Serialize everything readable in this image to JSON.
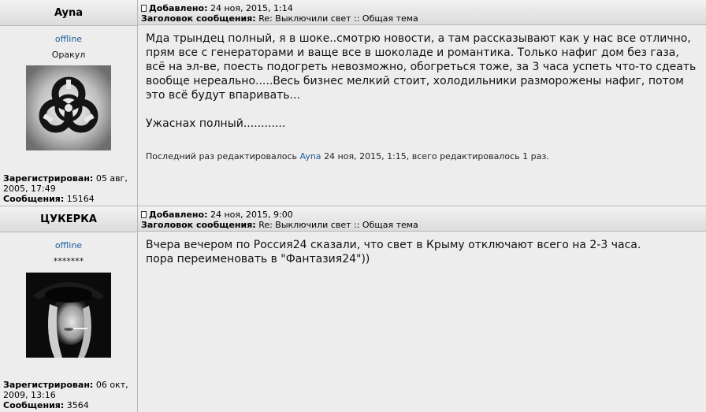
{
  "posts": [
    {
      "author": "Ayna",
      "status": "offline",
      "rank": "Оракул",
      "avatar_icon": "biohazard-icon",
      "registered_label": "Зарегистрирован:",
      "registered": "05 авг, 2005, 17:49",
      "messages_label": "Сообщения:",
      "messages": "15164",
      "added_label": "Добавлено:",
      "added": "24 ноя, 2015, 1:14",
      "subject_label": "Заголовок сообщения:",
      "subject": "Re: Выключили свет :: Общая тема",
      "body_lines": [
        "Мда трындец полный, я в шоке..смотрю новости, а там рассказывают как у нас все отлично,",
        "прям все с генераторами и ваще все в шоколаде и романтика. Только нафиг дом без газа,",
        "всё на эл-ве, поесть подогреть невозможно, обогреться тоже, за 3 часа успеть что-то сдеать",
        "вообще нереально.....Весь бизнес мелкий стоит, холодильники разморожены нафиг, потом",
        "это всё будут впаривать...",
        "",
        "Ужаснах полный............"
      ],
      "edit_prefix": "Последний раз редактировалось",
      "edit_author": "Ayna",
      "edit_suffix": "24 ноя, 2015, 1:15, всего редактировалось 1 раз."
    },
    {
      "author": "ЦУКЕРКА",
      "status": "offline",
      "rank": "*******",
      "avatar_icon": "woman-portrait-avatar",
      "registered_label": "Зарегистрирован:",
      "registered": "06 окт, 2009, 13:16",
      "messages_label": "Сообщения:",
      "messages": "3564",
      "added_label": "Добавлено:",
      "added": "24 ноя, 2015, 9:00",
      "subject_label": "Заголовок сообщения:",
      "subject": "Re: Выключили свет :: Общая тема",
      "body_lines": [
        "Вчера вечером по Россия24 сказали, что свет в Крыму отключают всего на 2-3 часа.",
        "пора переименовать в \"Фантазия24\"))"
      ]
    }
  ]
}
